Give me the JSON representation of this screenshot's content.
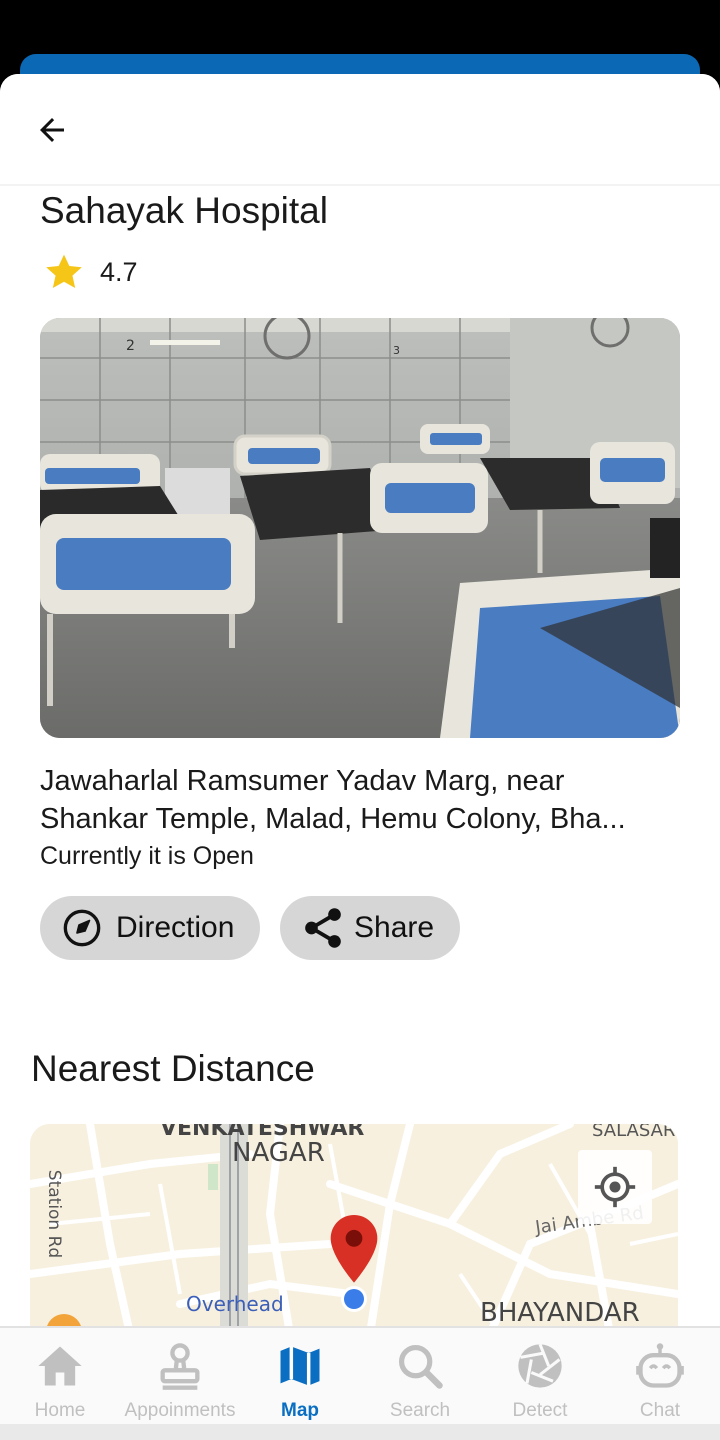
{
  "place": {
    "name": "Sahayak Hospital",
    "rating": "4.7",
    "address_line1": "Jawaharlal Ramsumer Yadav Marg, near",
    "address_line2": "Shankar Temple, Malad, Hemu Colony, Bha...",
    "status": "Currently it is Open"
  },
  "actions": {
    "direction_label": "Direction",
    "share_label": "Share"
  },
  "section": {
    "nearest_title": "Nearest Distance"
  },
  "map": {
    "label_top": "VENKATESHWAR",
    "label_nagar": "NAGAR",
    "label_salasar": "SALASAR",
    "label_station": "Station Rd",
    "label_jai_ambe": "Jai Ambe Rd",
    "label_overhead": "Overhead",
    "label_bhayandar": "BHAYANDAR"
  },
  "nav": {
    "items": [
      {
        "label": "Home",
        "icon": "home-icon"
      },
      {
        "label": "Appoinments",
        "icon": "appointment-stamp-icon"
      },
      {
        "label": "Map",
        "icon": "map-icon",
        "active": true
      },
      {
        "label": "Search",
        "icon": "search-icon"
      },
      {
        "label": "Detect",
        "icon": "aperture-icon"
      },
      {
        "label": "Chat",
        "icon": "robot-icon"
      }
    ]
  },
  "colors": {
    "accent": "#0a68b4",
    "active_nav": "#0a6fc2",
    "inactive_nav": "#c0c0c0",
    "star": "#f5c518",
    "chip_bg": "#d6d6d6",
    "map_pin": "#d93025"
  }
}
